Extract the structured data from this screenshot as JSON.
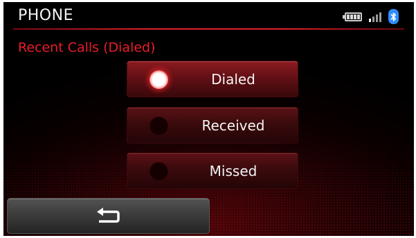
{
  "header": {
    "title": "PHONE",
    "status_icons": [
      "battery-icon",
      "signal-icon",
      "bluetooth-icon"
    ],
    "battery_level": 1.0,
    "signal_bars": {
      "active": 1,
      "total": 4
    }
  },
  "subtitle": "Recent Calls (Dialed)",
  "options": [
    {
      "label": "Dialed",
      "selected": true
    },
    {
      "label": "Received",
      "selected": false
    },
    {
      "label": "Missed",
      "selected": false
    }
  ],
  "back_button": {
    "icon": "back-arrow-icon"
  },
  "colors": {
    "accent": "#ea1c2a",
    "bluetooth": "#2f8cff",
    "background": "#000000"
  }
}
